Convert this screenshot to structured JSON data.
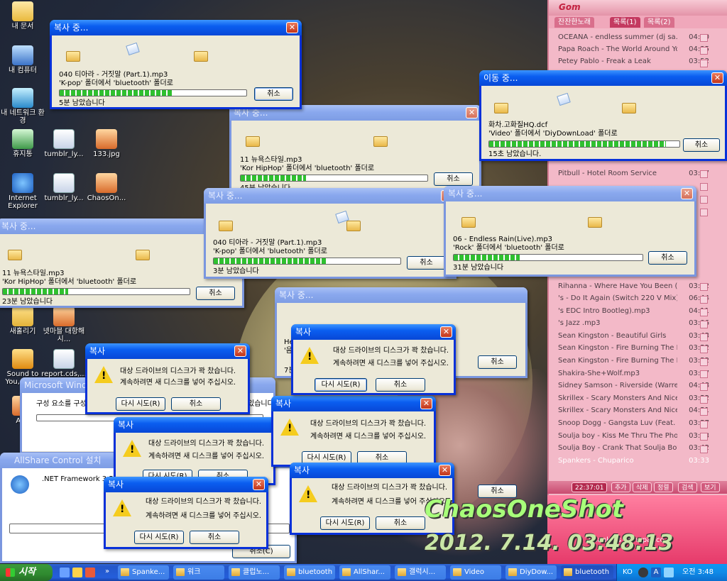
{
  "desktop": {
    "icons": [
      {
        "label": "내 문서"
      },
      {
        "label": "내 컴퓨터"
      },
      {
        "label": "내 네트워크 환경"
      },
      {
        "label": "휴지통"
      },
      {
        "label": "Internet Explorer"
      },
      {
        "label": "tumblr_ly..."
      },
      {
        "label": "133.jpg"
      },
      {
        "label": "tumblr_ly..."
      },
      {
        "label": "ChaosOn..."
      },
      {
        "label": "새홀리기"
      },
      {
        "label": "넷마블 대항해시..."
      },
      {
        "label": "Sound to You, WMA"
      },
      {
        "label": "report.cds,..."
      },
      {
        "label": "AVA"
      }
    ]
  },
  "copy_dialogs": [
    {
      "title": "복사 중...",
      "file": "040 티아라 - 거짓말 (Part.1).mp3",
      "route": "'K-pop' 폴더에서 'bluetooth' 폴더로",
      "remaining": "5분 남았습니다",
      "progress": 0.6
    },
    {
      "title": "복사 중...",
      "file": "11 뉴욕스타일.mp3",
      "route": "'Kor HipHop' 폴더에서 'bluetooth' 폴더로",
      "remaining": "45분 남았습니다",
      "progress": 0.35
    },
    {
      "title": "이동 중...",
      "file": "화차.고화질HQ.dcf",
      "route": "'Video' 폴더에서 'DiyDownLoad' 폴더로",
      "remaining": "15초 남았습니다.",
      "progress": 0.93
    },
    {
      "title": "복사 중...",
      "file": "040 티아라 - 거짓말 (Part.1).mp3",
      "route": "'K-pop' 폴더에서 'bluetooth' 폴더로",
      "remaining": "3분 남았습니다",
      "progress": 0.6
    },
    {
      "title": "복사 중...",
      "file": "06 - Endless Rain(Live).mp3",
      "route": "'Rock' 폴더에서 'bluetooth' 폴더로",
      "remaining": "31분 남았습니다",
      "progress": 0.35
    },
    {
      "title": "복사 중...",
      "file": "11 뉴욕스타일.mp3",
      "route": "'Kor HipHop' 폴더에서 'bluetooth' 폴더로",
      "remaining": "23분 남았습니다",
      "progress": 0.35
    },
    {
      "title": "복사 중...",
      "file": "He",
      "route": "'음",
      "remaining": "7분",
      "progress": 0.4
    }
  ],
  "error_dialogs": {
    "title": "복사",
    "line1": "대상 드라이브의 디스크가 꽉 찼습니다.",
    "line2": "계속하려면 새 디스크를 넣어 주십시오."
  },
  "buttons": {
    "cancel": "취소",
    "retry": "다시 시도(R)"
  },
  "ms_windows": {
    "title": "Microsoft Windo",
    "text": "구성 요소를 구성",
    "tail": "있습니다"
  },
  "allshare": {
    "title": "AllShare Control 설치",
    "text": ".NET Framework 3.5을",
    "button": "취소(C)"
  },
  "player": {
    "logo": "Gom",
    "tabs": [
      "잔잔한노래",
      "목록(1)",
      "목록(2)"
    ],
    "playlist": [
      {
        "title": "OCEANA - endless summer (dj sa...",
        "duration": "04:40"
      },
      {
        "title": "Papa Roach - The World Around You",
        "duration": "04:35"
      },
      {
        "title": "Petey Pablo - Freak a Leak",
        "duration": "03:52"
      },
      {
        "title": "Pitbull - Hotel Room Service",
        "duration": "03:57"
      },
      {
        "title": "Rihanna - Where Have You Been (...",
        "duration": "03:52"
      },
      {
        "title": "'s - Do It Again (Switch 220 V Mix)...",
        "duration": "06:44"
      },
      {
        "title": "'s EDC Intro Bootleg).mp3",
        "duration": "04:11"
      },
      {
        "title": "'s Jazz .mp3",
        "duration": "03:06"
      },
      {
        "title": "Sean Kingston - Beautiful Girls",
        "duration": "03:43"
      },
      {
        "title": "Sean Kingston - Fire Burning The D...",
        "duration": "03:52"
      },
      {
        "title": "Sean Kingston - Fire Burning The D...",
        "duration": "03:52"
      },
      {
        "title": "Shakira-She+Wolf.mp3",
        "duration": "03:07"
      },
      {
        "title": "Sidney Samson - Riverside (Warre...",
        "duration": "04:48"
      },
      {
        "title": "Skrillex - Scary Monsters And Nice...",
        "duration": "03:52"
      },
      {
        "title": "Skrillex - Scary Monsters And Nice...",
        "duration": "04:51"
      },
      {
        "title": "Snoop Dogg - Gangsta Luv (Feat. ...",
        "duration": "03:57"
      },
      {
        "title": "Soulja boy - Kiss Me Thru The Phone",
        "duration": "03:13"
      },
      {
        "title": "Soulja Boy - Crank That Soulja Boy",
        "duration": "03:42"
      },
      {
        "title": "Spankers - Chuparico",
        "duration": "03:33"
      }
    ],
    "clock": "22:37:01",
    "controls": [
      "추가",
      "삭제",
      "정렬",
      "검색",
      "보기"
    ],
    "now_playing": "Spankers - Chuparico"
  },
  "taskbar": {
    "start": "시작",
    "tasks": [
      "Spanke...",
      "워크",
      "클럽노...",
      "bluetooth",
      "AllShar...",
      "갤럭시...",
      "Video",
      "DiyDow...",
      "bluetooth"
    ],
    "lang": "KO",
    "time": "오전 3:48"
  },
  "watermark": {
    "name": "ChaosOneShot",
    "datetime": "2012. 7.14. 03:48:13"
  }
}
